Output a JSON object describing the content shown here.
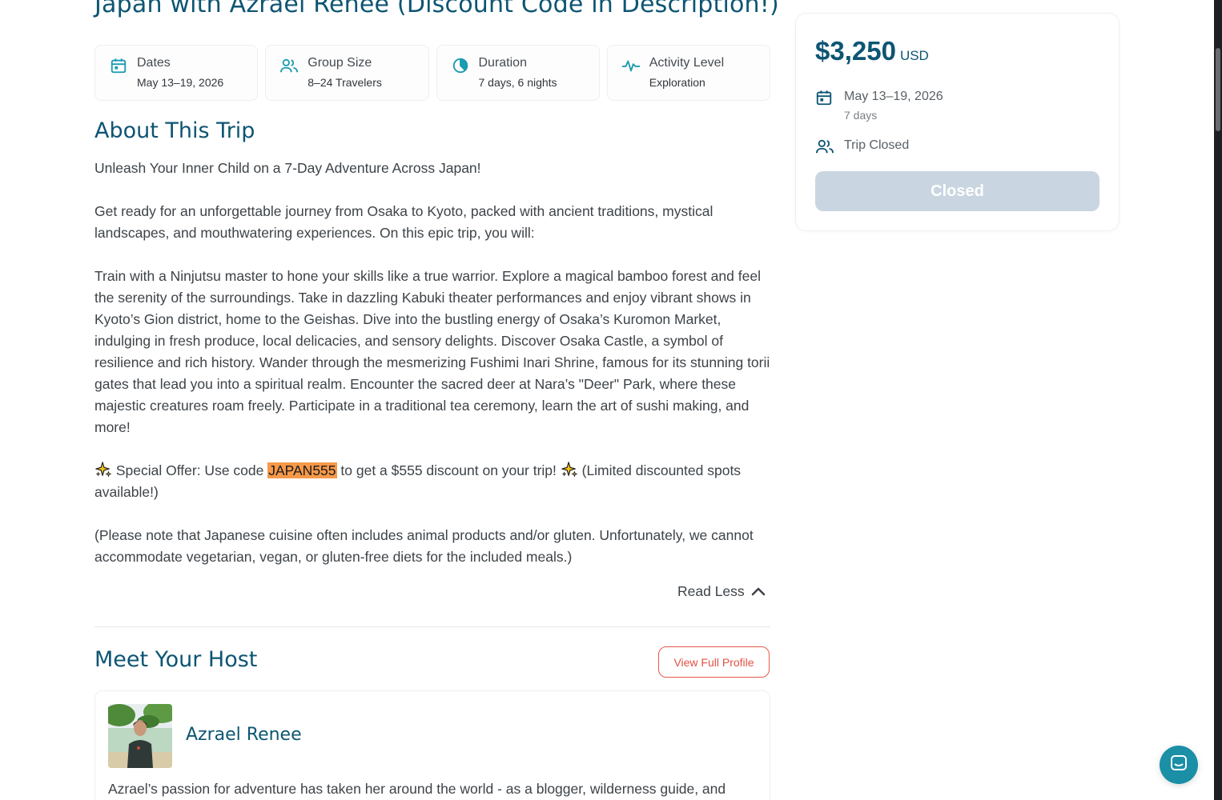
{
  "page": {
    "title": "Japan with Azrael Renee (Discount Code in Description!)"
  },
  "stats": [
    {
      "icon": "calendar-icon",
      "label": "Dates",
      "value": "May 13–19, 2026"
    },
    {
      "icon": "group-icon",
      "label": "Group Size",
      "value": "8–24 Travelers"
    },
    {
      "icon": "clock-pie-icon",
      "label": "Duration",
      "value": "7 days, 6 nights"
    },
    {
      "icon": "activity-icon",
      "label": "Activity Level",
      "value": "Exploration"
    }
  ],
  "about": {
    "heading": "About This Trip",
    "p1": "Unleash Your Inner Child on a 7-Day Adventure Across Japan!",
    "p2": "Get ready for an unforgettable journey from Osaka to Kyoto, packed with ancient traditions, mystical landscapes, and mouthwatering experiences. On this epic trip, you will:",
    "p3": "Train with a Ninjutsu master to hone your skills like a true warrior. Explore a magical bamboo forest and feel the serenity of the surroundings. Take in dazzling Kabuki theater performances and enjoy vibrant shows in Kyoto’s Gion district, home to the Geishas. Dive into the bustling energy of Osaka’s Kuromon Market, indulging in fresh produce, local delicacies, and sensory delights. Discover Osaka Castle, a symbol of resilience and rich history. Wander through the mesmerizing Fushimi Inari Shrine, famous for its stunning torii gates that lead you into a spiritual realm. Encounter the sacred deer at Nara’s \"Deer\" Park, where these majestic creatures roam freely. Participate in a traditional tea ceremony, learn the art of sushi making, and more!",
    "offer_prefix": " Special Offer: Use code ",
    "offer_code": "JAPAN555",
    "offer_mid": " to get a $555 discount on your trip! ",
    "offer_suffix": " (Limited discounted spots available!)",
    "p5": "(Please note that Japanese cuisine often includes animal products and/or gluten. Unfortunately, we cannot accommodate vegetarian, vegan, or gluten-free diets for the included meals.)",
    "read_less": "Read Less"
  },
  "host": {
    "heading": "Meet Your Host",
    "view_profile": "View Full Profile",
    "name": "Azrael Renee",
    "bio": "Azrael’s passion for adventure has taken her around the world - as a blogger, wilderness guide, and"
  },
  "booking": {
    "price": "$3,250",
    "currency": "USD",
    "dates": "May 13–19, 2026",
    "days": "7 days",
    "status": "Trip Closed",
    "button": "Closed"
  },
  "colors": {
    "accent": "#0d5573",
    "icon_teal": "#1a9bb0",
    "promo_highlight": "#f6994a",
    "cta_red": "#e05243",
    "disabled_button": "#c9d5e0"
  }
}
